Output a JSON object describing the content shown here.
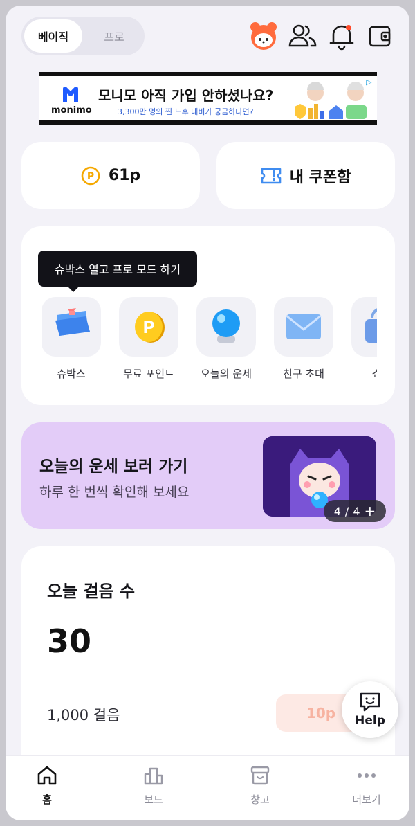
{
  "header": {
    "mode_basic": "베이직",
    "mode_pro": "프로"
  },
  "ad": {
    "brand": "monimo",
    "title": "모니모 아직 가입 안하셨나요?",
    "subtitle": "3,300만 명의 찐 노후 대비가 궁금하다면?"
  },
  "points": {
    "value": "61p"
  },
  "coupon": {
    "label": "내 쿠폰함"
  },
  "quick": {
    "tooltip": "슈박스 열고 프로 모드 하기",
    "items": [
      {
        "label": "슈박스"
      },
      {
        "label": "무료 포인트"
      },
      {
        "label": "오늘의 운세"
      },
      {
        "label": "친구 초대"
      },
      {
        "label": "쇼핑"
      }
    ]
  },
  "banner": {
    "title": "오늘의 운세 보러 가기",
    "subtitle": "하루 한 번씩 확인해 보세요",
    "counter_current": "4",
    "counter_sep": "/",
    "counter_total": "4",
    "counter_plus": "+"
  },
  "steps": {
    "title": "오늘 걸음 수",
    "value": "30",
    "goal": "1,000 걸음",
    "reward": "10p"
  },
  "help": {
    "label": "Help"
  },
  "nav": [
    {
      "label": "홈"
    },
    {
      "label": "보드"
    },
    {
      "label": "창고"
    },
    {
      "label": "더보기"
    }
  ],
  "colors": {
    "background": "#f3f2f8",
    "accent_orange": "#ff6b3d",
    "point_yellow": "#f5a800",
    "banner_purple": "#e3ccf8",
    "reward_bg": "#fde9e4"
  }
}
